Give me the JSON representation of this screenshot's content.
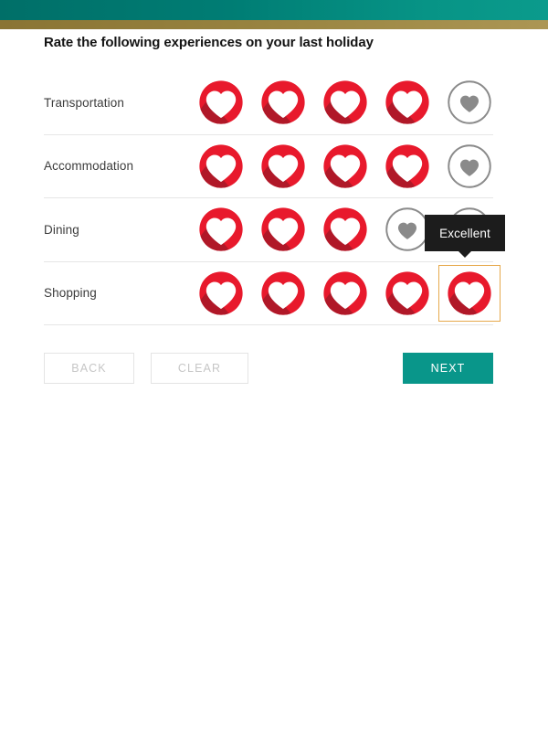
{
  "theme": {
    "band_teal_left": "#006f68",
    "band_teal_right": "#0b9b8c",
    "band_gold": "#97823f",
    "heart_selected": "#e8192c",
    "heart_shadow": "#b01828",
    "heart_empty": "#8a8a8a",
    "focus_outline": "#e6a94c",
    "tooltip_bg": "#1c1c1c",
    "next_button_bg": "#09968a",
    "disabled_text": "#c6c6c6",
    "row_divider": "#e6e6e6"
  },
  "header": {
    "title": "Rate the following experiences on your last holiday"
  },
  "rating": {
    "max": 5,
    "rows": [
      {
        "label": "Transportation",
        "value": 4,
        "icon": "heart-icon"
      },
      {
        "label": "Accommodation",
        "value": 4,
        "icon": "heart-icon"
      },
      {
        "label": "Dining",
        "value": 3,
        "icon": "heart-icon"
      },
      {
        "label": "Shopping",
        "value": 5,
        "icon": "heart-icon"
      }
    ],
    "focused_row": 3,
    "focused_index": 4
  },
  "tooltip": {
    "text": "Excellent",
    "anchor_row": "Shopping",
    "anchor_index": 5
  },
  "buttons": {
    "back": {
      "label": "BACK",
      "disabled": true
    },
    "clear": {
      "label": "CLEAR",
      "disabled": true
    },
    "next": {
      "label": "NEXT",
      "disabled": false
    }
  }
}
